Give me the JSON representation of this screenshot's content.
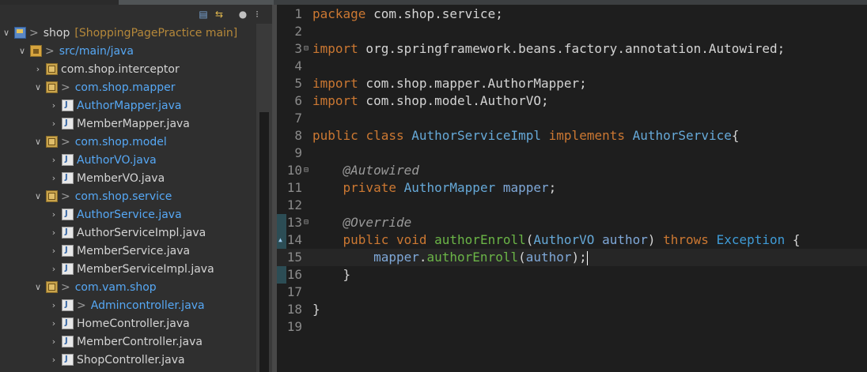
{
  "explorer": {
    "toolbar": {
      "icons": [
        "collapse-all-icon",
        "link-with-editor-icon",
        "view-menu-icon",
        "focus-icon"
      ]
    },
    "tree": [
      {
        "indent": 0,
        "arrow": "open",
        "icon": "project",
        "dirty": ">",
        "label": "shop",
        "suffix": "[ShoppingPagePractice main]"
      },
      {
        "indent": 1,
        "arrow": "open",
        "icon": "src-folder",
        "dirty": ">",
        "label": "src/main/java",
        "blue": true
      },
      {
        "indent": 2,
        "arrow": "closed",
        "icon": "package",
        "label": "com.shop.interceptor"
      },
      {
        "indent": 2,
        "arrow": "open",
        "icon": "package",
        "dirty": ">",
        "label": "com.shop.mapper",
        "blue": true
      },
      {
        "indent": 3,
        "arrow": "closed",
        "icon": "java-file",
        "label": "AuthorMapper.java",
        "blue": true
      },
      {
        "indent": 3,
        "arrow": "closed",
        "icon": "java-file",
        "label": "MemberMapper.java"
      },
      {
        "indent": 2,
        "arrow": "open",
        "icon": "package",
        "dirty": ">",
        "label": "com.shop.model",
        "blue": true
      },
      {
        "indent": 3,
        "arrow": "closed",
        "icon": "java-file",
        "label": "AuthorVO.java",
        "blue": true
      },
      {
        "indent": 3,
        "arrow": "closed",
        "icon": "java-file",
        "label": "MemberVO.java"
      },
      {
        "indent": 2,
        "arrow": "open",
        "icon": "package",
        "dirty": ">",
        "label": "com.shop.service",
        "blue": true
      },
      {
        "indent": 3,
        "arrow": "closed",
        "icon": "java-file",
        "label": "AuthorService.java",
        "blue": true
      },
      {
        "indent": 3,
        "arrow": "closed",
        "icon": "java-file",
        "label": "AuthorServiceImpl.java"
      },
      {
        "indent": 3,
        "arrow": "closed",
        "icon": "java-file",
        "label": "MemberService.java"
      },
      {
        "indent": 3,
        "arrow": "closed",
        "icon": "java-file",
        "label": "MemberServiceImpl.java"
      },
      {
        "indent": 2,
        "arrow": "open",
        "icon": "package",
        "dirty": ">",
        "label": "com.vam.shop",
        "blue": true
      },
      {
        "indent": 3,
        "arrow": "closed",
        "icon": "java-file",
        "dirty": ">",
        "label": "Admincontroller.java",
        "blue": true
      },
      {
        "indent": 3,
        "arrow": "closed",
        "icon": "java-file",
        "label": "HomeController.java"
      },
      {
        "indent": 3,
        "arrow": "closed",
        "icon": "java-file",
        "label": "MemberController.java"
      },
      {
        "indent": 3,
        "arrow": "closed",
        "icon": "java-file",
        "label": "ShopController.java"
      }
    ]
  },
  "editor": {
    "lines": [
      {
        "n": "1",
        "tokens": [
          [
            "kw",
            "package"
          ],
          [
            "pl",
            " com.shop.service;"
          ]
        ]
      },
      {
        "n": "2",
        "tokens": []
      },
      {
        "n": "3",
        "fold": "minus",
        "tokens": [
          [
            "kw",
            "import"
          ],
          [
            "pl",
            " org.springframework.beans.factory.annotation.Autowired;"
          ]
        ]
      },
      {
        "n": "4",
        "tokens": []
      },
      {
        "n": "5",
        "tokens": [
          [
            "kw",
            "import"
          ],
          [
            "pl",
            " com.shop.mapper.AuthorMapper;"
          ]
        ]
      },
      {
        "n": "6",
        "tokens": [
          [
            "kw",
            "import"
          ],
          [
            "pl",
            " com.shop.model.AuthorVO;"
          ]
        ]
      },
      {
        "n": "7",
        "tokens": []
      },
      {
        "n": "8",
        "tokens": [
          [
            "kw",
            "public"
          ],
          [
            "pl",
            " "
          ],
          [
            "kw",
            "class"
          ],
          [
            "pl",
            " "
          ],
          [
            "cls",
            "AuthorServiceImpl"
          ],
          [
            "pl",
            " "
          ],
          [
            "kw",
            "implements"
          ],
          [
            "pl",
            " "
          ],
          [
            "cls",
            "AuthorService"
          ],
          [
            "pl",
            "{"
          ]
        ]
      },
      {
        "n": "9",
        "tokens": []
      },
      {
        "n": "10",
        "fold": "minus",
        "tokens": [
          [
            "pl",
            "    "
          ],
          [
            "anno",
            "@Autowired"
          ]
        ]
      },
      {
        "n": "11",
        "tokens": [
          [
            "pl",
            "    "
          ],
          [
            "kw",
            "private"
          ],
          [
            "pl",
            " "
          ],
          [
            "cls",
            "AuthorMapper"
          ],
          [
            "pl",
            " "
          ],
          [
            "var",
            "mapper"
          ],
          [
            "pl",
            ";"
          ]
        ]
      },
      {
        "n": "12",
        "tokens": []
      },
      {
        "n": "13",
        "fold": "minus",
        "tokens": [
          [
            "pl",
            "    "
          ],
          [
            "anno",
            "@Override"
          ]
        ]
      },
      {
        "n": "14",
        "marker": "override",
        "tokens": [
          [
            "pl",
            "    "
          ],
          [
            "kw",
            "public"
          ],
          [
            "pl",
            " "
          ],
          [
            "kw",
            "void"
          ],
          [
            "pl",
            " "
          ],
          [
            "mth",
            "authorEnroll"
          ],
          [
            "pl",
            "("
          ],
          [
            "cls",
            "AuthorVO"
          ],
          [
            "pl",
            " "
          ],
          [
            "var",
            "author"
          ],
          [
            "pl",
            ") "
          ],
          [
            "kw",
            "throws"
          ],
          [
            "pl",
            " "
          ],
          [
            "excp",
            "Exception"
          ],
          [
            "pl",
            " {"
          ]
        ]
      },
      {
        "n": "15",
        "active": true,
        "caret": true,
        "tokens": [
          [
            "pl",
            "        "
          ],
          [
            "var",
            "mapper"
          ],
          [
            "pl",
            "."
          ],
          [
            "mth",
            "authorEnroll"
          ],
          [
            "pl",
            "("
          ],
          [
            "var",
            "author"
          ],
          [
            "pl",
            ");"
          ]
        ]
      },
      {
        "n": "16",
        "tokens": [
          [
            "pl",
            "    }"
          ]
        ]
      },
      {
        "n": "17",
        "tokens": []
      },
      {
        "n": "18",
        "tokens": [
          [
            "pl",
            "}"
          ]
        ]
      },
      {
        "n": "19",
        "tokens": []
      }
    ]
  },
  "colors": {
    "keyword": "#cc7832",
    "type": "#66a9d8",
    "method": "#6bb547",
    "field": "#7fa8d8",
    "annotation": "#9a9a9a",
    "explorer_bg": "#2f2f2f",
    "editor_bg": "#1e1e1e"
  }
}
